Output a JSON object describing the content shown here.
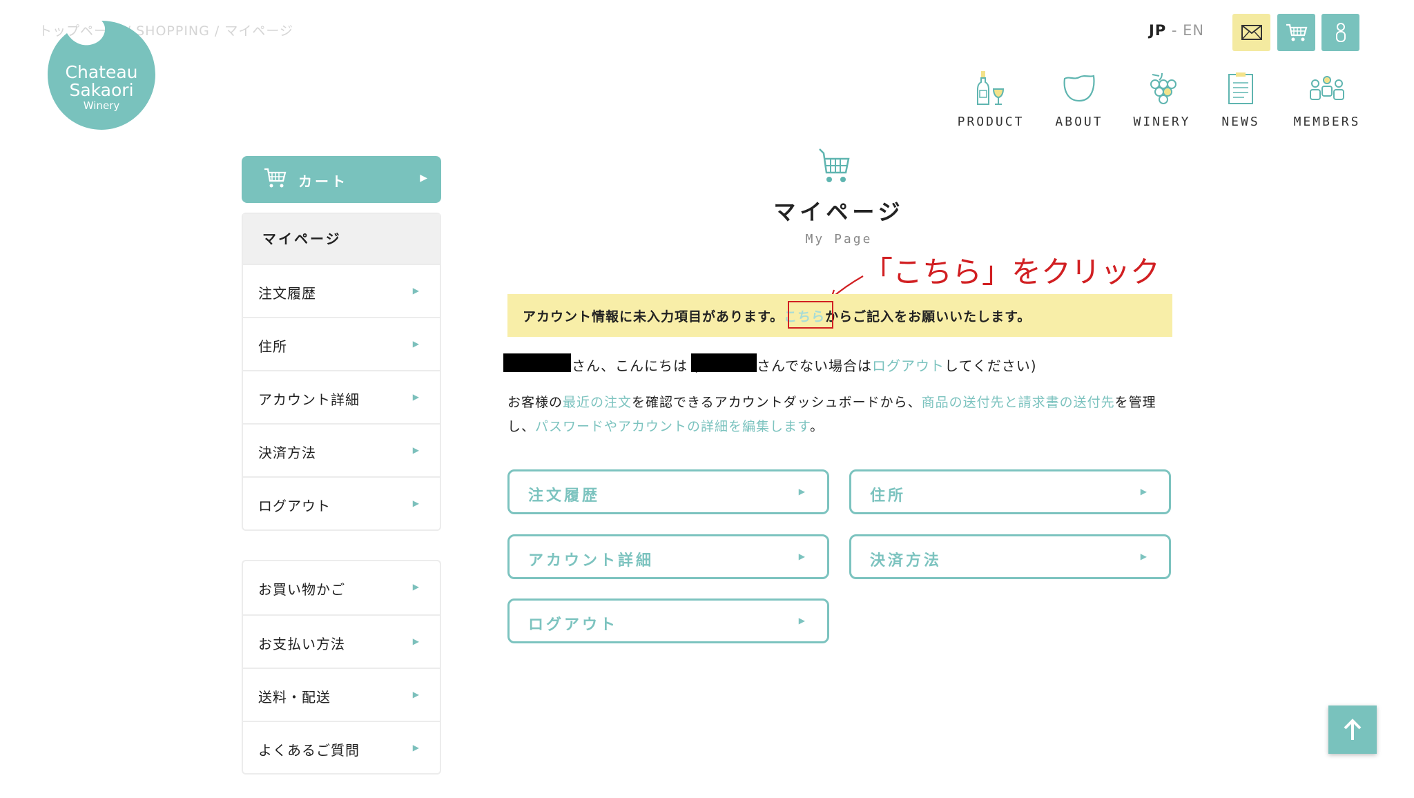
{
  "breadcrumb": "トップページ / SHOPPING / マイページ",
  "logo": {
    "line1": "Chateau",
    "line2": "Sakaori",
    "line3": "Winery"
  },
  "lang": {
    "jp": "JP",
    "sep": " - ",
    "en": "EN"
  },
  "top_icons": {
    "mail": "mail-icon",
    "cart": "cart-icon",
    "user": "user-icon"
  },
  "nav": [
    {
      "label": "PRODUCT",
      "icon": "wine-bottle-icon"
    },
    {
      "label": "ABOUT",
      "icon": "cup-icon"
    },
    {
      "label": "WINERY",
      "icon": "grape-icon"
    },
    {
      "label": "NEWS",
      "icon": "clipboard-icon"
    },
    {
      "label": "MEMBERS",
      "icon": "people-icon"
    }
  ],
  "sidebar": {
    "cart_label": "カート",
    "heading": "マイページ",
    "items": [
      "注文履歴",
      "住所",
      "アカウント詳細",
      "決済方法",
      "ログアウト"
    ],
    "items2": [
      "お買い物かご",
      "お支払い方法",
      "送料・配送",
      "よくあるご質問"
    ],
    "arrow": "▶"
  },
  "page": {
    "title": "マイページ",
    "subtitle": "My Page"
  },
  "annotation": "「こちら」をクリック",
  "notice": {
    "before": "アカウント情報に未入力項目があります。",
    "link": "こちら",
    "after": "からご記入をお願いいたします。"
  },
  "greeting": {
    "part1": "さん、こんにちは (",
    "part2": "さんでない場合は",
    "logout_link": "ログアウト",
    "part3": "してください)"
  },
  "description": {
    "p1": "お客様の",
    "link1": "最近の注文",
    "p2": "を確認できるアカウントダッシュボードから、",
    "link2": "商品の送付先と請求書の送付先",
    "p3": "を管理し、",
    "link3": "パスワードやアカウントの詳細を編集します",
    "p4": "。"
  },
  "buttons": [
    "注文履歴",
    "住所",
    "アカウント詳細",
    "決済方法",
    "ログアウト"
  ],
  "colors": {
    "teal": "#79c2bd",
    "yellow": "#f8eea8",
    "annotation_red": "#d11f22"
  }
}
